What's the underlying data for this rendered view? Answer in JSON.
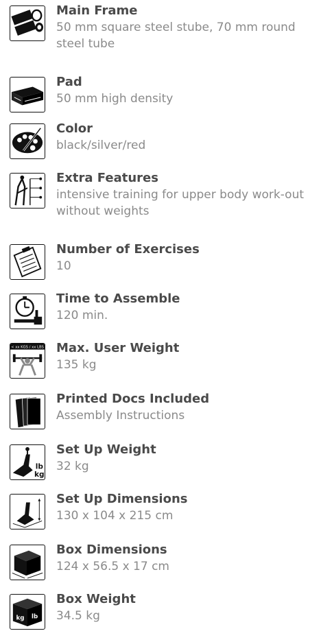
{
  "specs": [
    {
      "icon": "steel-tube-icon",
      "title": "Main Frame",
      "value": "50 mm square steel stube, 70 mm round steel tube"
    },
    {
      "icon": "pad-icon",
      "title": "Pad",
      "value": "50 mm high density"
    },
    {
      "icon": "color-palette-icon",
      "title": "Color",
      "value": "black/silver/red"
    },
    {
      "icon": "extra-features-icon",
      "title": "Extra Features",
      "value": "intensive training for upper body work-out without weights"
    },
    {
      "icon": "clipboard-icon",
      "title": "Number of Exercises",
      "value": "10"
    },
    {
      "icon": "stopwatch-tools-icon",
      "title": "Time to Assemble",
      "value": "120 min."
    },
    {
      "icon": "weightlifter-icon",
      "title": "Max. User Weight",
      "value": "135 kg",
      "icon_label": "< xx KGS / xx LBS"
    },
    {
      "icon": "documents-icon",
      "title": "Printed Docs Included",
      "value": "Assembly Instructions"
    },
    {
      "icon": "setup-weight-icon",
      "title": "Set Up Weight",
      "value": "32 kg",
      "icon_label_top": "lb",
      "icon_label_bottom": "kg"
    },
    {
      "icon": "setup-dimensions-icon",
      "title": "Set Up Dimensions",
      "value": "130 x 104 x 215 cm"
    },
    {
      "icon": "box-dimensions-icon",
      "title": "Box Dimensions",
      "value": "124 x 56.5 x 17 cm"
    },
    {
      "icon": "box-weight-icon",
      "title": "Box Weight",
      "value": "34.5 kg",
      "icon_label_left": "kg",
      "icon_label_right": "lb"
    }
  ]
}
